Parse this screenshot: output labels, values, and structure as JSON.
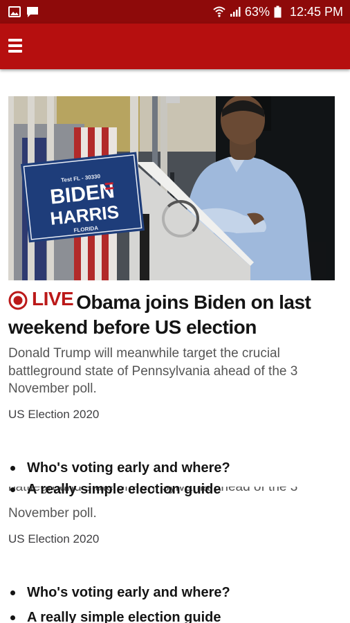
{
  "status_bar": {
    "battery": "63%",
    "time": "12:45 PM",
    "icons": [
      "image-notification-icon",
      "message-notification-icon",
      "wifi-icon",
      "signal-icon",
      "battery-icon"
    ]
  },
  "app_bar": {
    "menu_icon": "hamburger-menu-icon",
    "color": "#b60f0f"
  },
  "article": {
    "image": {
      "sign_top": "Test FL - 30330",
      "sign_line1": "BIDEN",
      "sign_line2": "HARRIS",
      "sign_line3": "FLORIDA"
    },
    "live_label": "LIVE",
    "live_color": "#bb1919",
    "title": "Obama joins Biden on last weekend before US election",
    "summary": "Donald Trump will meanwhile target the crucial battleground state of Pennsylvania ahead of the 3 November poll.",
    "section": "US Election 2020",
    "related_links": [
      "Who's voting early and where?",
      "A really simple election guide"
    ]
  },
  "ghost_overlay": {
    "summary_line1": "battleground state of Pennsylvania ahead of the 3",
    "summary_line2": "November poll.",
    "section": "US Election 2020",
    "related_links": [
      "Who's voting early and where?",
      "A really simple election guide"
    ]
  }
}
